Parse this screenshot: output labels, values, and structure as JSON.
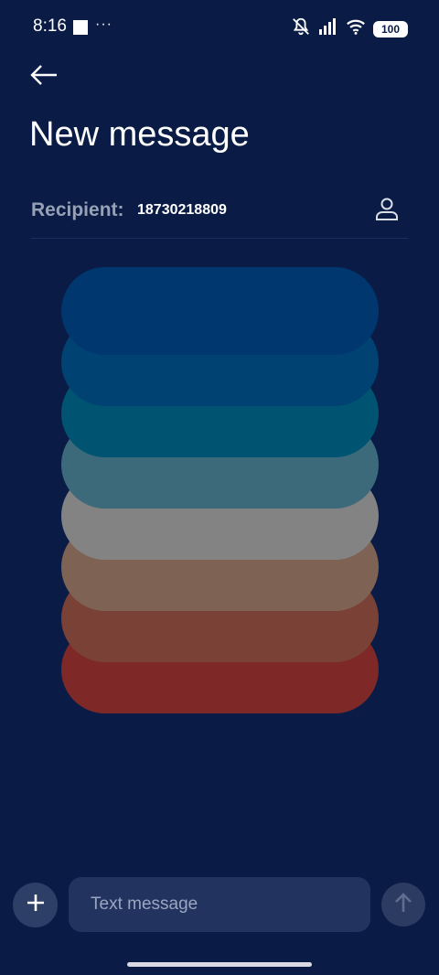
{
  "status_bar": {
    "time": "8:16",
    "dots": "···",
    "battery": "100",
    "icons": [
      "silent-bell-icon",
      "signal-icon",
      "wifi-icon",
      "battery-icon"
    ]
  },
  "header": {
    "back_icon": "arrow-left-icon",
    "title": "New message"
  },
  "recipient": {
    "label": "Recipient:",
    "value": "18730218809",
    "contact_icon": "person-icon"
  },
  "attachment": {
    "pills": [
      {
        "color": "#00376f"
      },
      {
        "color": "#004373"
      },
      {
        "color": "#005472"
      },
      {
        "color": "#3d6a7b"
      },
      {
        "color": "#848384"
      },
      {
        "color": "#7e6253"
      },
      {
        "color": "#7a4237"
      },
      {
        "color": "#7e2927"
      }
    ]
  },
  "composer": {
    "add_icon": "plus-icon",
    "placeholder": "Text message",
    "send_icon": "arrow-up-icon"
  },
  "colors": {
    "background": "#0a1c45",
    "input_background": "#223360",
    "button_background": "#2d3f66",
    "label_gray": "#97a0b5"
  }
}
